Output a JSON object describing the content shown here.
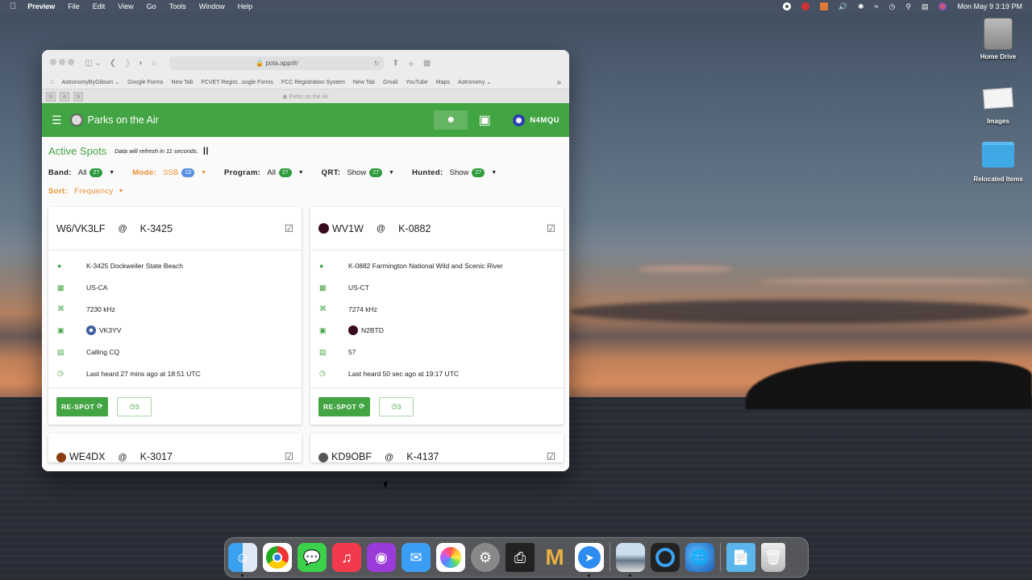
{
  "menubar": {
    "app_name": "Preview",
    "menus": [
      "File",
      "Edit",
      "View",
      "Go",
      "Tools",
      "Window",
      "Help"
    ],
    "clock": "Mon May 9  3:19 PM"
  },
  "desktop": {
    "items": [
      {
        "label": "Home Drive",
        "icon": "hard-drive-icon"
      },
      {
        "label": "Images",
        "icon": "images-stack-icon"
      },
      {
        "label": "Relocated Items",
        "icon": "folder-icon"
      }
    ]
  },
  "browser": {
    "url": "pota.app/#/",
    "bookmarks": [
      "AstronomyByGibson ⌄",
      "Google Forms",
      "New Tab",
      "FCVET Regist...oogle Forms",
      "FCC Registration System",
      "New Tab",
      "Gmail",
      "YouTube",
      "Maps",
      "Astronomy ⌄"
    ],
    "tab_title": "Parks on the Air"
  },
  "app": {
    "title": "Parks on the Air",
    "user_callsign": "N4MQU",
    "accent_color": "#43a443",
    "section_title": "Active Spots",
    "refresh_text": "Data will refresh in 11 seconds.",
    "filters": [
      {
        "label": "Band:",
        "value": "All",
        "count": "27",
        "highlight": false
      },
      {
        "label": "Mode:",
        "value": "SSB",
        "count": "13",
        "highlight": true
      },
      {
        "label": "Program:",
        "value": "All",
        "count": "27",
        "highlight": false
      },
      {
        "label": "QRT:",
        "value": "Show",
        "count": "27",
        "highlight": false
      },
      {
        "label": "Hunted:",
        "value": "Show",
        "count": "27",
        "highlight": false
      }
    ],
    "sort": {
      "label": "Sort:",
      "value": "Frequency"
    },
    "respot_label": "RE-SPOT",
    "spots": [
      {
        "activator": "W6/VK3LF",
        "at": "@",
        "park": "K-3425",
        "park_line": "K-3425  Dockweiler State Beach",
        "location": "US-CA",
        "frequency": "7230 kHz",
        "spotter": "VK3YV",
        "comment": "Calling CQ",
        "last_heard": "Last heard 27 mins ago at 18:51 UTC",
        "history_count": "3"
      },
      {
        "activator": "WV1W",
        "at": "@",
        "park": "K-0882",
        "park_line": "K-0882  Farmington National Wild and Scenic River",
        "location": "US-CT",
        "frequency": "7274 kHz",
        "spotter": "N2BTD",
        "comment": "57",
        "last_heard": "Last heard 50 sec ago at 19:17 UTC",
        "history_count": "3"
      },
      {
        "activator": "WE4DX",
        "at": "@",
        "park": "K-3017"
      },
      {
        "activator": "KD9OBF",
        "at": "@",
        "park": "K-4137"
      }
    ]
  },
  "dock": {
    "apps": [
      "Finder",
      "Chrome",
      "Messages",
      "Music",
      "Podcasts",
      "Mail",
      "Photos",
      "System Preferences",
      "Printer",
      "MaximDL",
      "Safari",
      "Preview",
      "QuickTime Player",
      "Network Utility",
      "Downloads",
      "Trash"
    ]
  }
}
